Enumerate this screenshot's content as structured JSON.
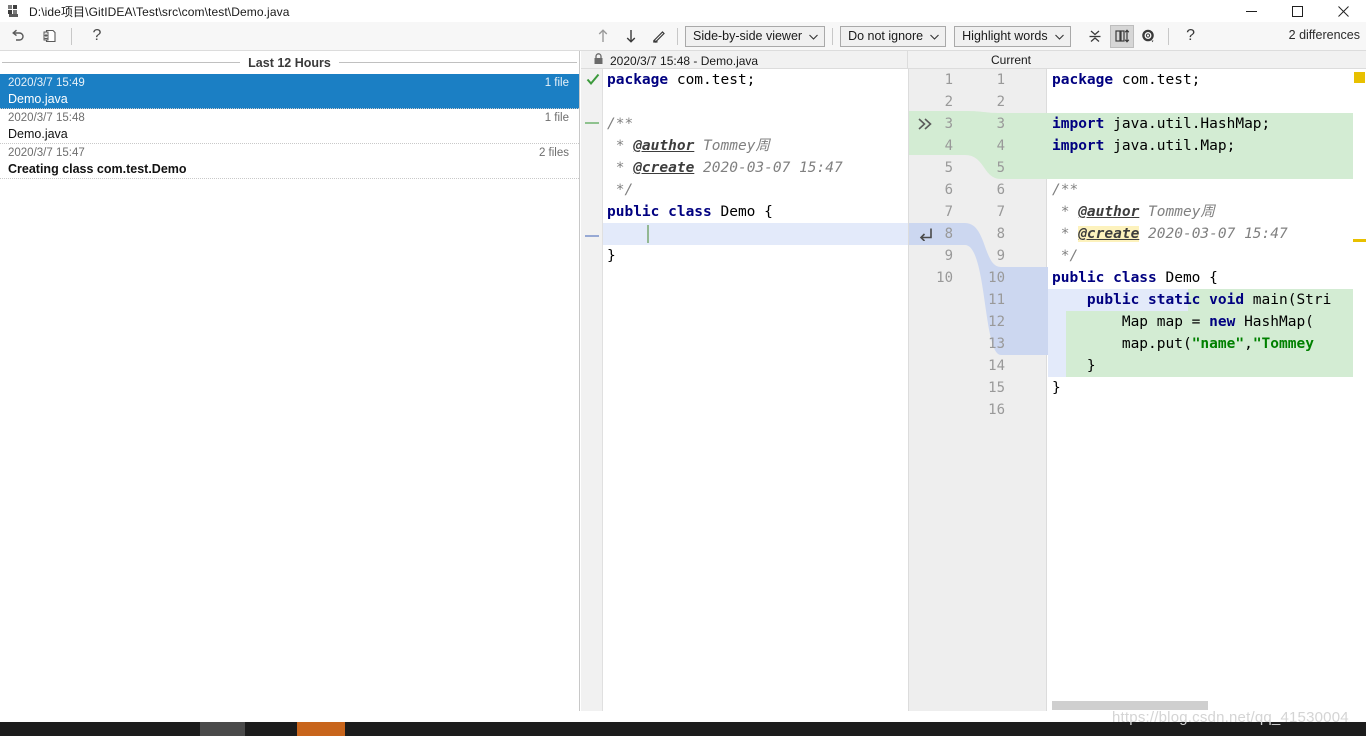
{
  "window": {
    "title": "D:\\ide项目\\GitIDEA\\Test\\src\\com\\test\\Demo.java",
    "minimize_label": "Minimize",
    "maximize_label": "Maximize",
    "close_label": "Close"
  },
  "main_toolbar": {
    "revert_icon": "revert-icon",
    "diff_icon": "create-patch-icon",
    "help_icon": "help-icon"
  },
  "diff_toolbar": {
    "prev_label": "Previous difference",
    "next_label": "Next difference",
    "edit_label": "Edit source",
    "viewer_mode": "Side-by-side viewer",
    "ignore_policy": "Do not ignore",
    "highlight_mode": "Highlight words",
    "collapse_label": "Collapse unchanged fragments",
    "align_label": "Align for side-by-side",
    "settings_label": "Settings",
    "help_label": "?",
    "differences_count": "2 differences",
    "chevron": "⌄"
  },
  "history": {
    "group_label": "Last 12 Hours",
    "items": [
      {
        "date": "2020/3/7 15:49",
        "name": "Demo.java",
        "count": "1 file",
        "selected": true,
        "bold": false
      },
      {
        "date": "2020/3/7 15:48",
        "name": "Demo.java",
        "count": "1 file",
        "selected": false,
        "bold": false
      },
      {
        "date": "2020/3/7 15:47",
        "name": "Creating class com.test.Demo",
        "count": "2 files",
        "selected": false,
        "bold": true
      }
    ]
  },
  "diff_header": {
    "left_title": "2020/3/7 15:48 - Demo.java",
    "right_title": "Current",
    "lock_icon": "lock-icon"
  },
  "left_code": {
    "line_numbers": [
      "1",
      "2",
      "3",
      "4",
      "5",
      "6",
      "7",
      "8",
      "9",
      "10"
    ],
    "lines": [
      "package com.test;",
      "",
      "/**",
      " * @author Tommey周",
      " * @create 2020-03-07 15:47",
      " */",
      "public class Demo {",
      "",
      "}",
      ""
    ]
  },
  "right_code": {
    "line_numbers": [
      "1",
      "2",
      "3",
      "4",
      "5",
      "6",
      "7",
      "8",
      "9",
      "10",
      "11",
      "12",
      "13",
      "14",
      "15",
      "16"
    ],
    "lines": [
      "package com.test;",
      "",
      "import java.util.HashMap;",
      "import java.util.Map;",
      "",
      "/**",
      " * @author Tommey周",
      " * @create 2020-03-07 15:47",
      " */",
      "public class Demo {",
      "    public static void main(Stri",
      "        Map map = new HashMap(",
      "        map.put(\"name\",\"Tommey",
      "    }",
      "}",
      ""
    ]
  },
  "gutter": {
    "accept_icon": "chevron-double-right-icon",
    "insert_icon": "insert-arrow-icon"
  },
  "watermark": "https://blog.csdn.net/qq_41530004",
  "colors": {
    "selection_blue": "#1b7fc4",
    "added_green": "#d3ecd3",
    "changed_blue": "#ccd7f0",
    "marker_yellow": "#e8c000",
    "keyword_navy": "#000080",
    "string_green": "#008000",
    "comment_gray": "#808080"
  }
}
